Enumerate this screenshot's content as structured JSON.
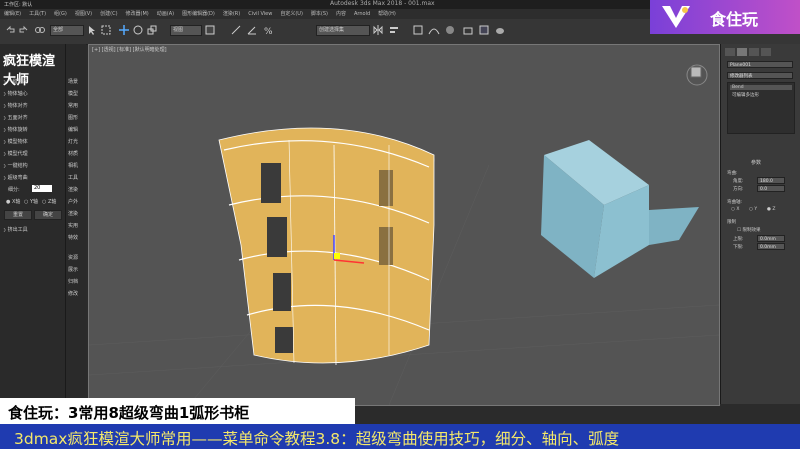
{
  "app": {
    "window_title": "Autodesk 3ds Max 2018 - 001.max",
    "workspace": "工作区: 默认"
  },
  "menu": [
    "编辑(E)",
    "工具(T)",
    "组(G)",
    "视图(V)",
    "创建(C)",
    "修改器(M)",
    "动画(A)",
    "图形编辑器(D)",
    "渲染(R)",
    "Civil View",
    "自定义(U)",
    "脚本(S)",
    "内容",
    "Arnold",
    "帮助(H)"
  ],
  "toolbar": {
    "selection_filter": "全部",
    "view_dropdown": "视图",
    "named_selection": "创建选择集"
  },
  "brand": {
    "name": "食住玩"
  },
  "left_panel": {
    "title": "疯狂模渲大师",
    "items": [
      "一键量尺",
      "物体轴心",
      "物体对齐",
      "五面对齐",
      "物体旋转",
      "模型物体",
      "模型代理",
      "一键结构",
      "超级弯曲"
    ],
    "subdiv_label": "细分:",
    "subdiv_value": "20",
    "axis_options": [
      "X轴",
      "Y轴",
      "Z轴"
    ],
    "buttons": [
      "重置",
      "确定"
    ],
    "export_item": "挤出工具"
  },
  "tab_column": [
    "场景",
    "模型",
    "常用",
    "图形",
    "编辑",
    "灯光",
    "材质",
    "相机",
    "工具",
    "渲染",
    "户外",
    "渲染",
    "实用",
    "特效",
    "",
    "",
    "资源",
    "展示",
    "归档",
    "修改"
  ],
  "viewport": {
    "label": "[+] [透视] [标准] [默认明暗处理]"
  },
  "right_panel": {
    "object_name": "Plane001",
    "modifier_list": "修改器列表",
    "stack": [
      "Bend",
      "可编辑多边形"
    ],
    "params_title": "参数",
    "bend_label": "弯曲:",
    "angle_label": "角度:",
    "angle_value": "180.0",
    "direction_label": "方向:",
    "direction_value": "0.0",
    "axis_label": "弯曲轴:",
    "axes": [
      "X",
      "Y",
      "Z"
    ],
    "limit_label": "限制",
    "limit_checkbox": "限制效果",
    "upper_label": "上限:",
    "upper_value": "0.0mm",
    "lower_label": "下限:",
    "lower_value": "0.0mm"
  },
  "captions": {
    "line1": "食住玩：3常用8超级弯曲1弧形书柜",
    "line2": "3dmax疯狂模渲大师常用——菜单命令教程3.8：超级弯曲使用技巧，细分、轴向、弧度"
  },
  "colors": {
    "viewport_bg": "#545454",
    "shelf_wood": "#e1b45a",
    "box_blue": "#7fb3c4",
    "caption_bar": "#1f3bb0",
    "caption_text": "#f4e86a",
    "brand_purple": "#8a42d6"
  }
}
